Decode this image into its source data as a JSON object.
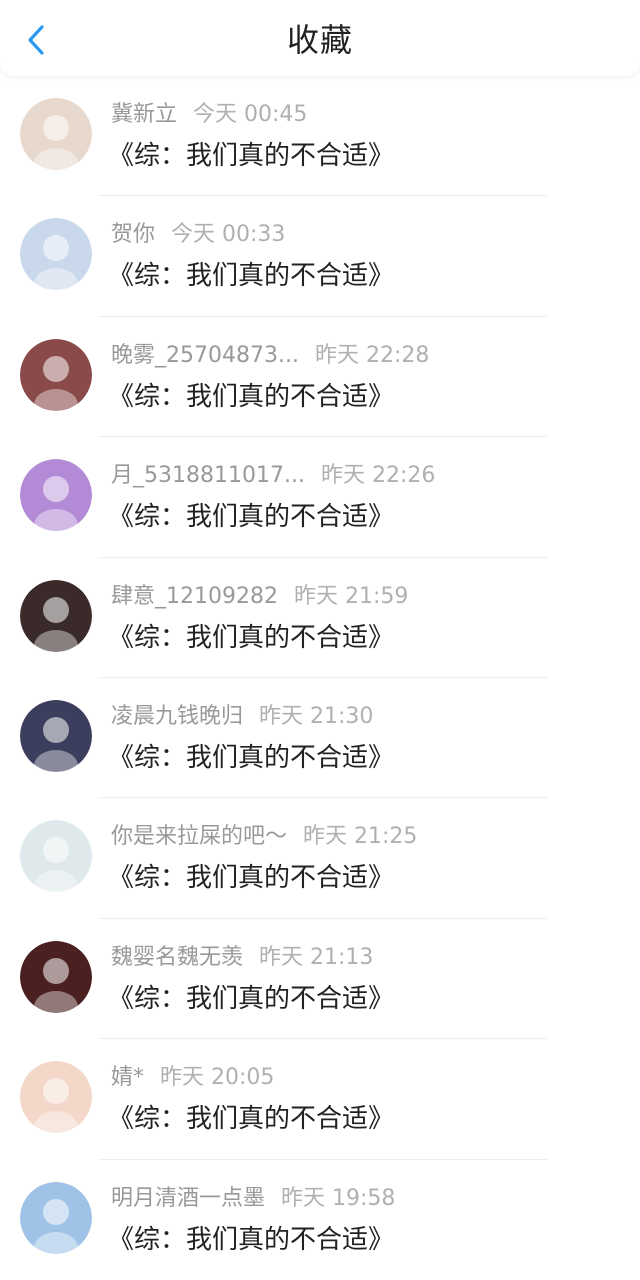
{
  "header": {
    "title": "收藏",
    "back_icon": "chevron-left-icon",
    "accent": "#2b9af3"
  },
  "items": [
    {
      "user": "冀新立",
      "time": "今天 00:45",
      "title": "《综：我们真的不合适》",
      "avatar_color": "#e8d9cf"
    },
    {
      "user": "贺你",
      "time": "今天 00:33",
      "title": "《综：我们真的不合适》",
      "avatar_color": "#c9d8ea"
    },
    {
      "user": "晚雾_25704873...",
      "time": "昨天 22:28",
      "title": "《综：我们真的不合适》",
      "avatar_color": "#8a4a4a"
    },
    {
      "user": "月_5318811017...",
      "time": "昨天 22:26",
      "title": "《综：我们真的不合适》",
      "avatar_color": "#b28ad6"
    },
    {
      "user": "肆意_12109282",
      "time": "昨天 21:59",
      "title": "《综：我们真的不合适》",
      "avatar_color": "#3a2a2a"
    },
    {
      "user": "凌晨九钱晚归",
      "time": "昨天 21:30",
      "title": "《综：我们真的不合适》",
      "avatar_color": "#3b3e5c"
    },
    {
      "user": "你是来拉屎的吧～",
      "time": "昨天 21:25",
      "title": "《综：我们真的不合适》",
      "avatar_color": "#dfe9ec"
    },
    {
      "user": "魏婴名魏无羡",
      "time": "昨天 21:13",
      "title": "《综：我们真的不合适》",
      "avatar_color": "#4a2020"
    },
    {
      "user": "婧*",
      "time": "昨天 20:05",
      "title": "《综：我们真的不合适》",
      "avatar_color": "#f3d7c8"
    },
    {
      "user": "明月清酒一点墨",
      "time": "昨天 19:58",
      "title": "《综：我们真的不合适》",
      "avatar_color": "#9fc3e6"
    }
  ]
}
